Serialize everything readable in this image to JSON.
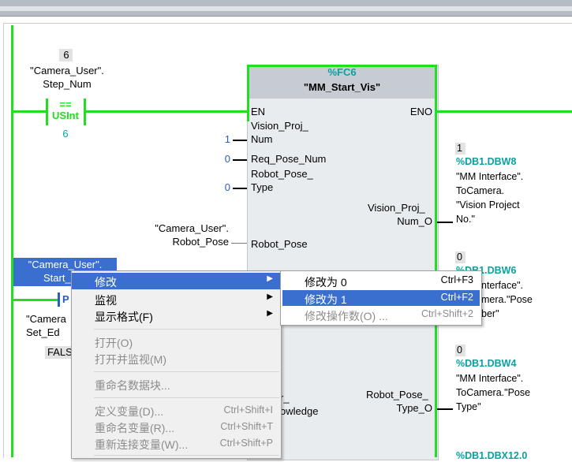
{
  "network": {
    "step_compare": {
      "value_above": "6",
      "operand_line1": "\"Camera_User\".",
      "operand_line2": "Step_Num",
      "operator": "==",
      "type": "USInt",
      "value_below": "6"
    },
    "block": {
      "address": "%FC6",
      "name": "\"MM_Start_Vis\"",
      "pin_en": "EN",
      "pin_eno": "ENO",
      "in_vision_proj_1": "Vision_Proj_",
      "in_vision_proj_2": "Num",
      "in_vision_proj_value": "1",
      "in_req_pose": "Req_Pose_Num",
      "in_req_pose_value": "0",
      "in_robot_pose_type_1": "Robot_Pose_",
      "in_robot_pose_type_2": "Type",
      "in_robot_pose_type_value": "0",
      "in_robot_pose": "Robot_Pose",
      "in_robot_pose_src_1": "\"Camera_User\".",
      "in_robot_pose_src_2": "Robot_Pose",
      "in_ack_partial_1": "r_",
      "in_ack_partial_2": "owledge",
      "out_vision_proj_1": "Vision_Proj_",
      "out_vision_proj_2": "Num_O",
      "out_robot_pose_type_1": "Robot_Pose_",
      "out_robot_pose_type_2": "Type_O"
    },
    "outputs": {
      "o1_value": "1",
      "o1_address": "%DB1.DBW8",
      "o1_line1": "\"MM Interface\".",
      "o1_line2": "ToCamera.",
      "o1_line3": "\"Vision Project",
      "o1_line4": "No.\"",
      "o2_value": "0",
      "o2_address": "%DB1.DBW6",
      "o2_line1": "nterface\".",
      "o2_line2": "mera.\"Pose",
      "o2_line3": "ber\"",
      "o3_value": "0",
      "o3_address": "%DB1.DBW4",
      "o3_line1": "\"MM Interface\".",
      "o3_line2": "ToCamera.\"Pose",
      "o3_line3": "Type\"",
      "o4_address_partial": "%DB1.DBX12.0"
    },
    "contacts": {
      "selected_line1": "\"Camera_User\".",
      "selected_line2": "Start_",
      "contact_p": "P",
      "edge_line1": "\"Camera",
      "edge_line2": "Set_Ed",
      "edge_value": "FALS"
    }
  },
  "context_menu": {
    "modify": "修改",
    "monitor": "监视",
    "display_format": "显示格式(F)",
    "open": "打开(O)",
    "open_and_monitor": "打开并监视(M)",
    "rename_db": "重命名数据块...",
    "define_var": "定义变量(D)...",
    "define_var_sc": "Ctrl+Shift+I",
    "rename_var": "重命名变量(R)...",
    "rename_var_sc": "Ctrl+Shift+T",
    "rewire_var": "重新连接变量(W)...",
    "rewire_var_sc": "Ctrl+Shift+P"
  },
  "submenu": {
    "modify_to_0": "修改为 0",
    "modify_to_0_sc": "Ctrl+F3",
    "modify_to_1": "修改为 1",
    "modify_to_1_sc": "Ctrl+F2",
    "modify_operand": "修改操作数(O) ...",
    "modify_operand_sc": "Ctrl+Shift+2"
  },
  "colors": {
    "powerflow": "#22dd22",
    "address_teal": "#0ba0a0",
    "selection": "#3a6fd0"
  }
}
